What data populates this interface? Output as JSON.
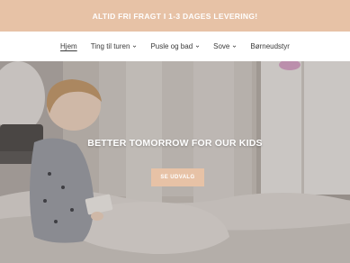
{
  "announcement": {
    "text": "ALTID FRI FRAGT I 1-3 DAGES LEVERING!"
  },
  "nav": {
    "items": [
      {
        "label": "Hjem",
        "active": true,
        "dropdown": false
      },
      {
        "label": "Ting til turen",
        "active": false,
        "dropdown": true
      },
      {
        "label": "Pusle og bad",
        "active": false,
        "dropdown": true
      },
      {
        "label": "Sove",
        "active": false,
        "dropdown": true
      },
      {
        "label": "Børneudstyr",
        "active": false,
        "dropdown": false
      }
    ]
  },
  "hero": {
    "title": "BETTER TOMORROW FOR OUR KIDS",
    "button_label": "SE UDVALG"
  },
  "colors": {
    "accent": "#e7c2a6",
    "text": "#3a3a3a"
  }
}
